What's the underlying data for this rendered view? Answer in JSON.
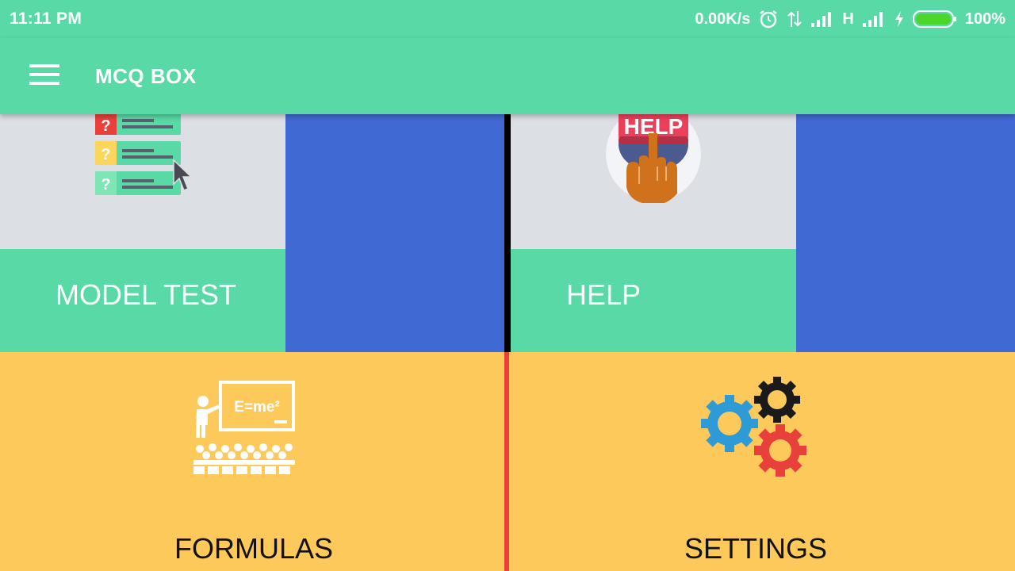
{
  "status_bar": {
    "time": "11:11 PM",
    "net_speed": "0.00K/s",
    "network_type": "H",
    "battery": "100%",
    "icons": [
      "alarm-icon",
      "data-arrows-icon",
      "signal-icon",
      "signal-icon",
      "charging-icon",
      "battery-icon"
    ]
  },
  "app_bar": {
    "title": "MCQ BOX",
    "menu_icon": "hamburger-menu-icon"
  },
  "tiles": {
    "model_test": {
      "label": "MODEL TEST",
      "icon": "quiz-list-icon"
    },
    "help": {
      "label": "HELP",
      "icon": "help-button-icon",
      "icon_text": "HELP"
    },
    "formulas": {
      "label": "FORMULAS",
      "icon": "classroom-blackboard-icon",
      "icon_text": "E=me²"
    },
    "settings": {
      "label": "SETTINGS",
      "icon": "gears-icon"
    }
  },
  "colors": {
    "primary": "#58d9a5",
    "blue": "#4169d4",
    "image_bg": "#dcdfe4",
    "yellow": "#fec95b",
    "divider_black": "#000000",
    "divider_red": "#e8403a"
  }
}
